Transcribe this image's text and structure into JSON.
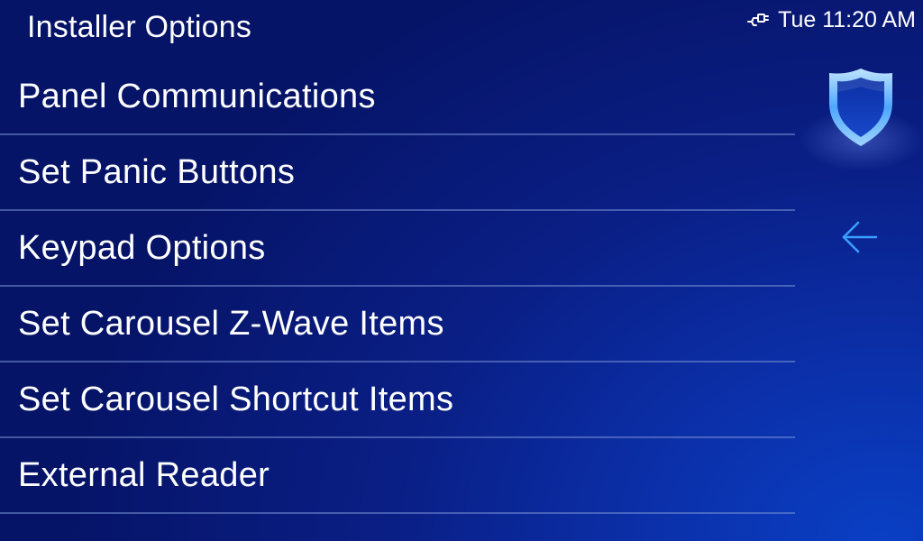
{
  "header": {
    "title": "Installer Options"
  },
  "status": {
    "network_icon": "ethernet-icon",
    "time": "Tue 11:20 AM"
  },
  "menu": {
    "items": [
      {
        "label": "Panel Communications"
      },
      {
        "label": "Set Panic Buttons"
      },
      {
        "label": "Keypad Options"
      },
      {
        "label": "Set Carousel Z-Wave Items"
      },
      {
        "label": "Set Carousel Shortcut Items"
      },
      {
        "label": "External Reader"
      }
    ]
  },
  "side": {
    "logo_icon": "shield-icon",
    "back_icon": "back-arrow-icon"
  },
  "colors": {
    "background_dark": "#061468",
    "background_light": "#0a3fc4",
    "divider": "#7891d2",
    "accent": "#3aa0ff",
    "text": "#ffffff"
  }
}
